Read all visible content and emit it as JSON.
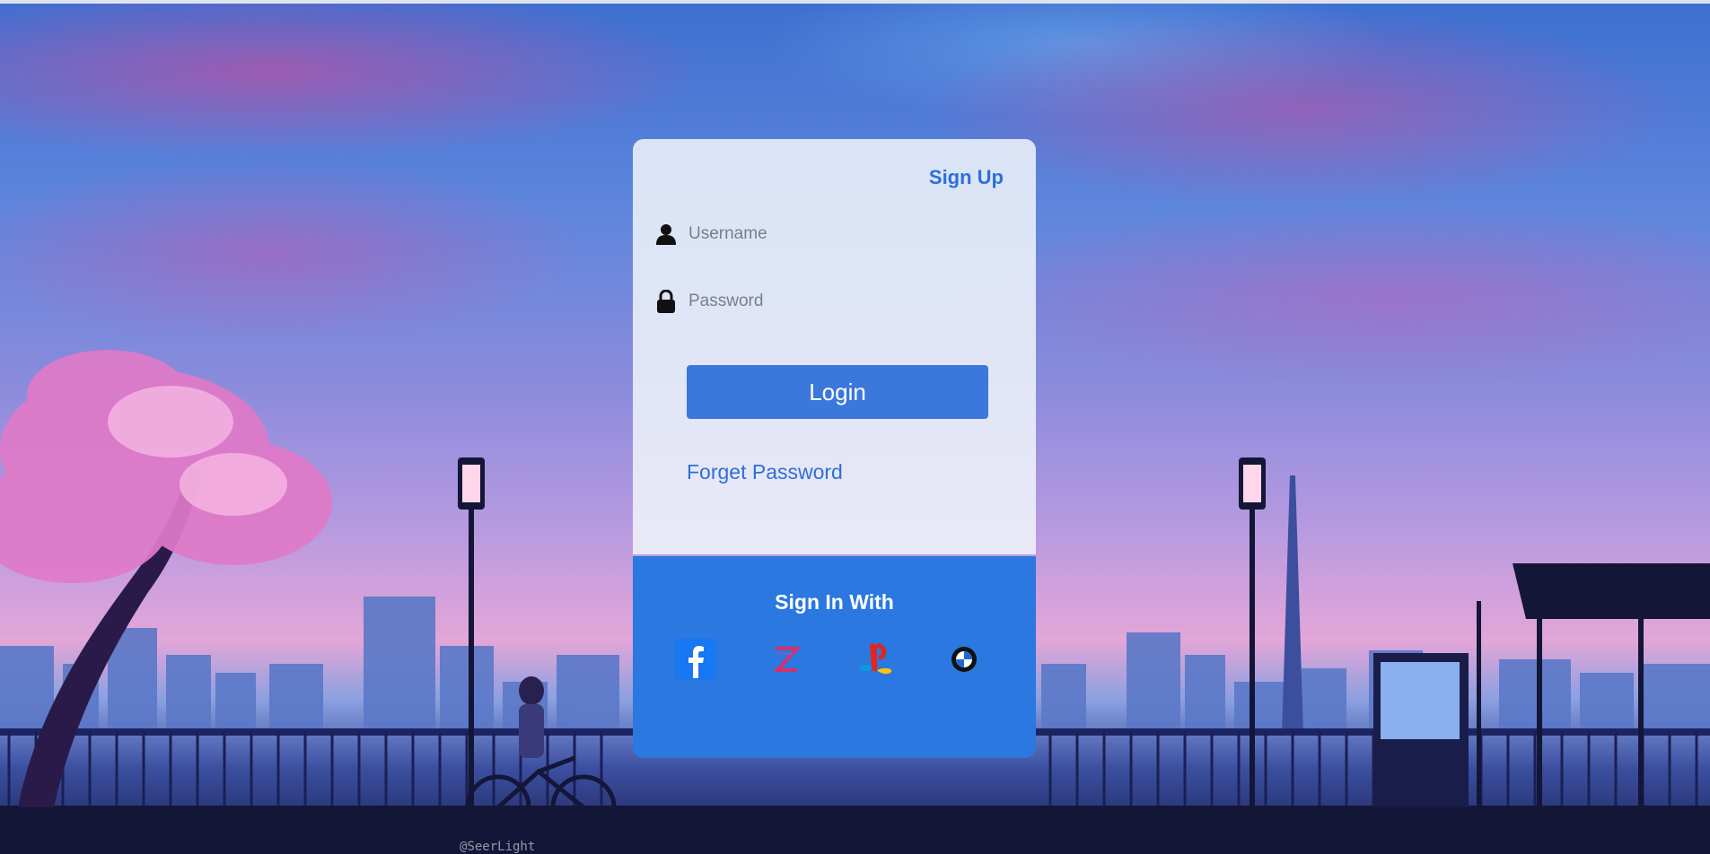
{
  "login": {
    "signup_label": "Sign Up",
    "username_placeholder": "Username",
    "password_placeholder": "Password",
    "login_label": "Login",
    "forgot_label": "Forget Password"
  },
  "social": {
    "title": "Sign In With",
    "providers": [
      {
        "name": "facebook",
        "icon": "facebook-icon"
      },
      {
        "name": "custom-z",
        "icon": "z-logo-icon"
      },
      {
        "name": "playstation",
        "icon": "playstation-icon"
      },
      {
        "name": "bmw",
        "icon": "bmw-icon"
      }
    ]
  },
  "background": {
    "credit": "@SeerLight"
  },
  "colors": {
    "accent": "#2a78e0",
    "link": "#2f6fd6",
    "button": "#3a78dc"
  }
}
